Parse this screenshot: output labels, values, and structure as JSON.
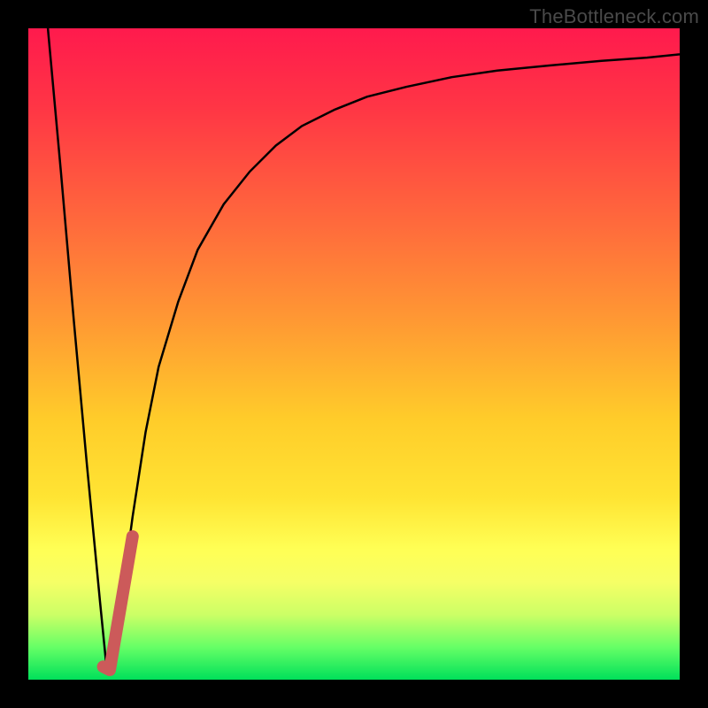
{
  "watermark": "TheBottleneck.com",
  "chart_data": {
    "type": "line",
    "title": "",
    "xlabel": "",
    "ylabel": "",
    "xlim": [
      0,
      100
    ],
    "ylim": [
      0,
      100
    ],
    "grid": false,
    "series": [
      {
        "name": "black-curve",
        "color": "#000000",
        "width": 2,
        "x": [
          3,
          5,
          7,
          9,
          11,
          12,
          13,
          14,
          16,
          18,
          20,
          23,
          26,
          30,
          34,
          38,
          42,
          47,
          52,
          58,
          65,
          72,
          80,
          88,
          95,
          100
        ],
        "y": [
          100,
          78,
          55,
          33,
          12,
          2,
          2,
          10,
          25,
          38,
          48,
          58,
          66,
          73,
          78,
          82,
          85,
          87.5,
          89.5,
          91,
          92.5,
          93.5,
          94.3,
          95,
          95.5,
          96
        ]
      },
      {
        "name": "red-segment",
        "color": "#cc5a5a",
        "width": 14,
        "cap": "round",
        "x": [
          11.5,
          12.5,
          16.0
        ],
        "y": [
          2.0,
          1.5,
          22.0
        ]
      }
    ]
  }
}
